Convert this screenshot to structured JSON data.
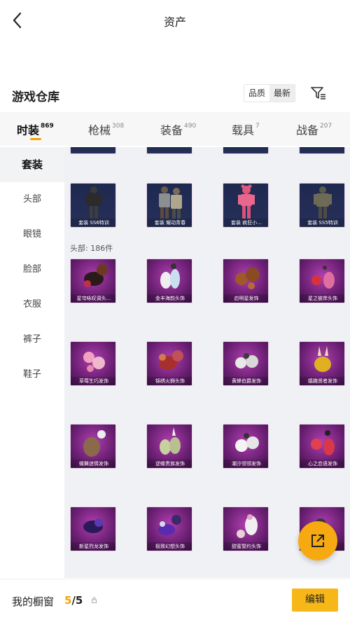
{
  "header": {
    "title": "资产",
    "back_icon": "back-arrow-icon"
  },
  "warehouse": {
    "title": "游戏仓库",
    "sort_options": [
      "品质",
      "最新"
    ],
    "filter_icon": "filter-icon"
  },
  "tabs": [
    {
      "label": "时装",
      "count": "869",
      "active": true
    },
    {
      "label": "枪械",
      "count": "308",
      "active": false
    },
    {
      "label": "装备",
      "count": "490",
      "active": false
    },
    {
      "label": "载具",
      "count": "7",
      "active": false
    },
    {
      "label": "战备",
      "count": "207",
      "active": false
    }
  ],
  "sidebar": {
    "items": [
      {
        "label": "套装",
        "active": true
      },
      {
        "label": "头部",
        "active": false
      },
      {
        "label": "眼镜",
        "active": false
      },
      {
        "label": "脸部",
        "active": false
      },
      {
        "label": "衣服",
        "active": false
      },
      {
        "label": "裤子",
        "active": false
      },
      {
        "label": "鞋子",
        "active": false
      }
    ]
  },
  "suits": [
    {
      "name": "套装 SS6特训"
    },
    {
      "name": "套装 耀动青春"
    },
    {
      "name": "套装 疯狂小..."
    },
    {
      "name": "套装 SS5特训"
    }
  ],
  "head_section": {
    "label": "头部: 186件",
    "items": [
      {
        "name": "星穹咏叹调头..."
      },
      {
        "name": "金丰海韵头饰"
      },
      {
        "name": "启明星发饰"
      },
      {
        "name": "星之彼岸头饰"
      },
      {
        "name": "草莓生巧发饰"
      },
      {
        "name": "锦绣火狮头饰"
      },
      {
        "name": "黄蜂伯爵发饰"
      },
      {
        "name": "嬉趣贤者发饰"
      },
      {
        "name": "蝶舞迷情发饰"
      },
      {
        "name": "逆蝶贵族发饰"
      },
      {
        "name": "潮汐领领发饰"
      },
      {
        "name": "心之恋语发饰"
      },
      {
        "name": "新星烈龙发饰"
      },
      {
        "name": "极致幻想头饰"
      },
      {
        "name": "甜蜜誓约头饰"
      },
      {
        "name": ""
      }
    ]
  },
  "fab": {
    "icon": "share-out-icon"
  },
  "showcase": {
    "label": "我的橱窗",
    "current": "5",
    "total": "/5",
    "edit_label": "编辑"
  },
  "colors": {
    "accent": "#f5a400",
    "button": "#f7b719",
    "suit_card_bg": "#232c55",
    "head_card_bg": "#8a2a8f"
  }
}
